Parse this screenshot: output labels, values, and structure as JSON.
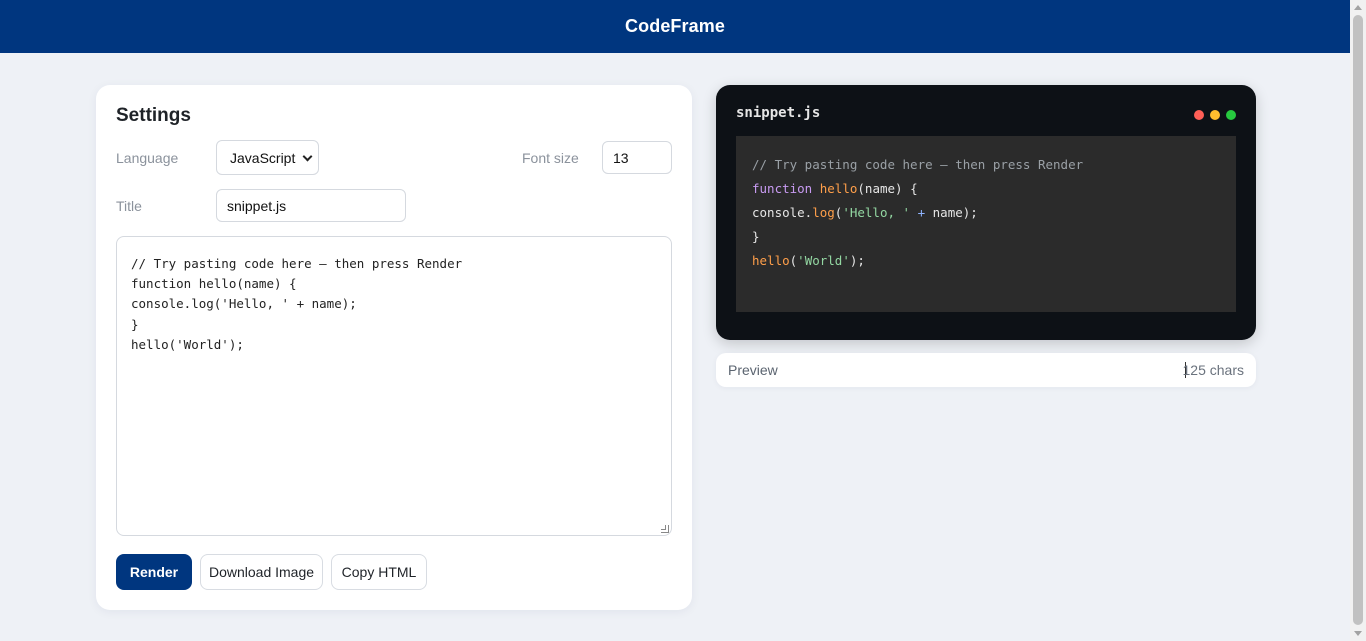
{
  "app": {
    "brand": "CodeFrame"
  },
  "settings": {
    "heading": "Settings",
    "language_label": "Language",
    "language_value": "JavaScript",
    "font_size_label": "Font size",
    "font_size_value": "13",
    "title_label": "Title",
    "title_value": "snippet.js",
    "code_lines": [
      "// Try pasting code here — then press Render",
      "function hello(name) {",
      "console.log('Hello, ' + name);",
      "}",
      "hello('World');"
    ]
  },
  "buttons": {
    "render": "Render",
    "download": "Download Image",
    "copy": "Copy HTML"
  },
  "preview": {
    "file_title": "snippet.js",
    "window_dots": {
      "red": "#ff5f56",
      "yellow": "#ffbd2e",
      "green": "#27c93f"
    },
    "line1_comment": "// Try pasting code here — then press Render",
    "line2_kw": "function",
    "line2_fn": "hello",
    "line2_rest": "(name) {",
    "line3_pre": "console.",
    "line3_fn": "log",
    "line3_paren": "(",
    "line3_str": "'Hello, '",
    "line3_op": "+",
    "line3_rest": "name);",
    "line4": "}",
    "line5_fn": "hello",
    "line5_paren": "(",
    "line5_str": "'World'",
    "line5_rest": ");",
    "status_label": "Preview",
    "char_count": "125 chars"
  },
  "colors": {
    "brand_blue": "#00367f",
    "page_bg": "#eef1f6",
    "frame_bg": "#0d1116",
    "code_bg": "#2b2b2b"
  }
}
